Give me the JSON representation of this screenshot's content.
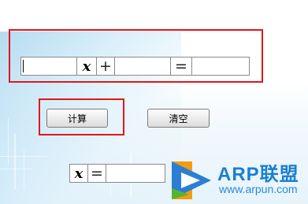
{
  "equation": {
    "operand_a": "",
    "variable": "x",
    "plus": "+",
    "operand_b": "",
    "equals": "=",
    "result_field": ""
  },
  "buttons": {
    "calculate": "计算",
    "clear": "清空"
  },
  "answer": {
    "variable": "x",
    "equals": "=",
    "value": ""
  },
  "watermark": {
    "brand": "ARP联盟",
    "url": "www.arpun.com",
    "icon": "play-icon",
    "colors": {
      "orange": "#f39c12",
      "blue": "#2a7fd4",
      "green": "#55b532",
      "text": "#1b7fd1"
    }
  },
  "highlight_color": "#e0161c"
}
